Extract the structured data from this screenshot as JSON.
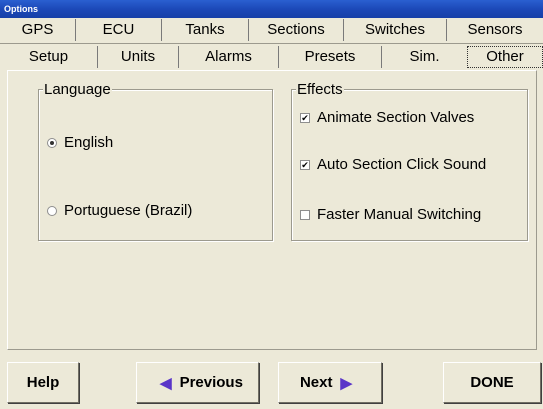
{
  "window": {
    "title": "Options"
  },
  "tabs": {
    "row1": [
      "GPS",
      "ECU",
      "Tanks",
      "Sections",
      "Switches",
      "Sensors"
    ],
    "row2": [
      "Setup",
      "Units",
      "Alarms",
      "Presets",
      "Sim.",
      "Other"
    ],
    "active": "Other"
  },
  "language": {
    "legend": "Language",
    "options": [
      {
        "label": "English",
        "selected": true
      },
      {
        "label": "Portuguese (Brazil)",
        "selected": false
      }
    ]
  },
  "effects": {
    "legend": "Effects",
    "options": [
      {
        "label": "Animate Section Valves",
        "checked": true
      },
      {
        "label": "Auto Section Click Sound",
        "checked": true
      },
      {
        "label": "Faster Manual Switching",
        "checked": false
      }
    ]
  },
  "footer": {
    "help": "Help",
    "previous": "Previous",
    "next": "Next",
    "done": "DONE"
  },
  "colors": {
    "titlebar": "#1c49b8",
    "arrow": "#5a35c8",
    "background": "#ece9d8"
  }
}
